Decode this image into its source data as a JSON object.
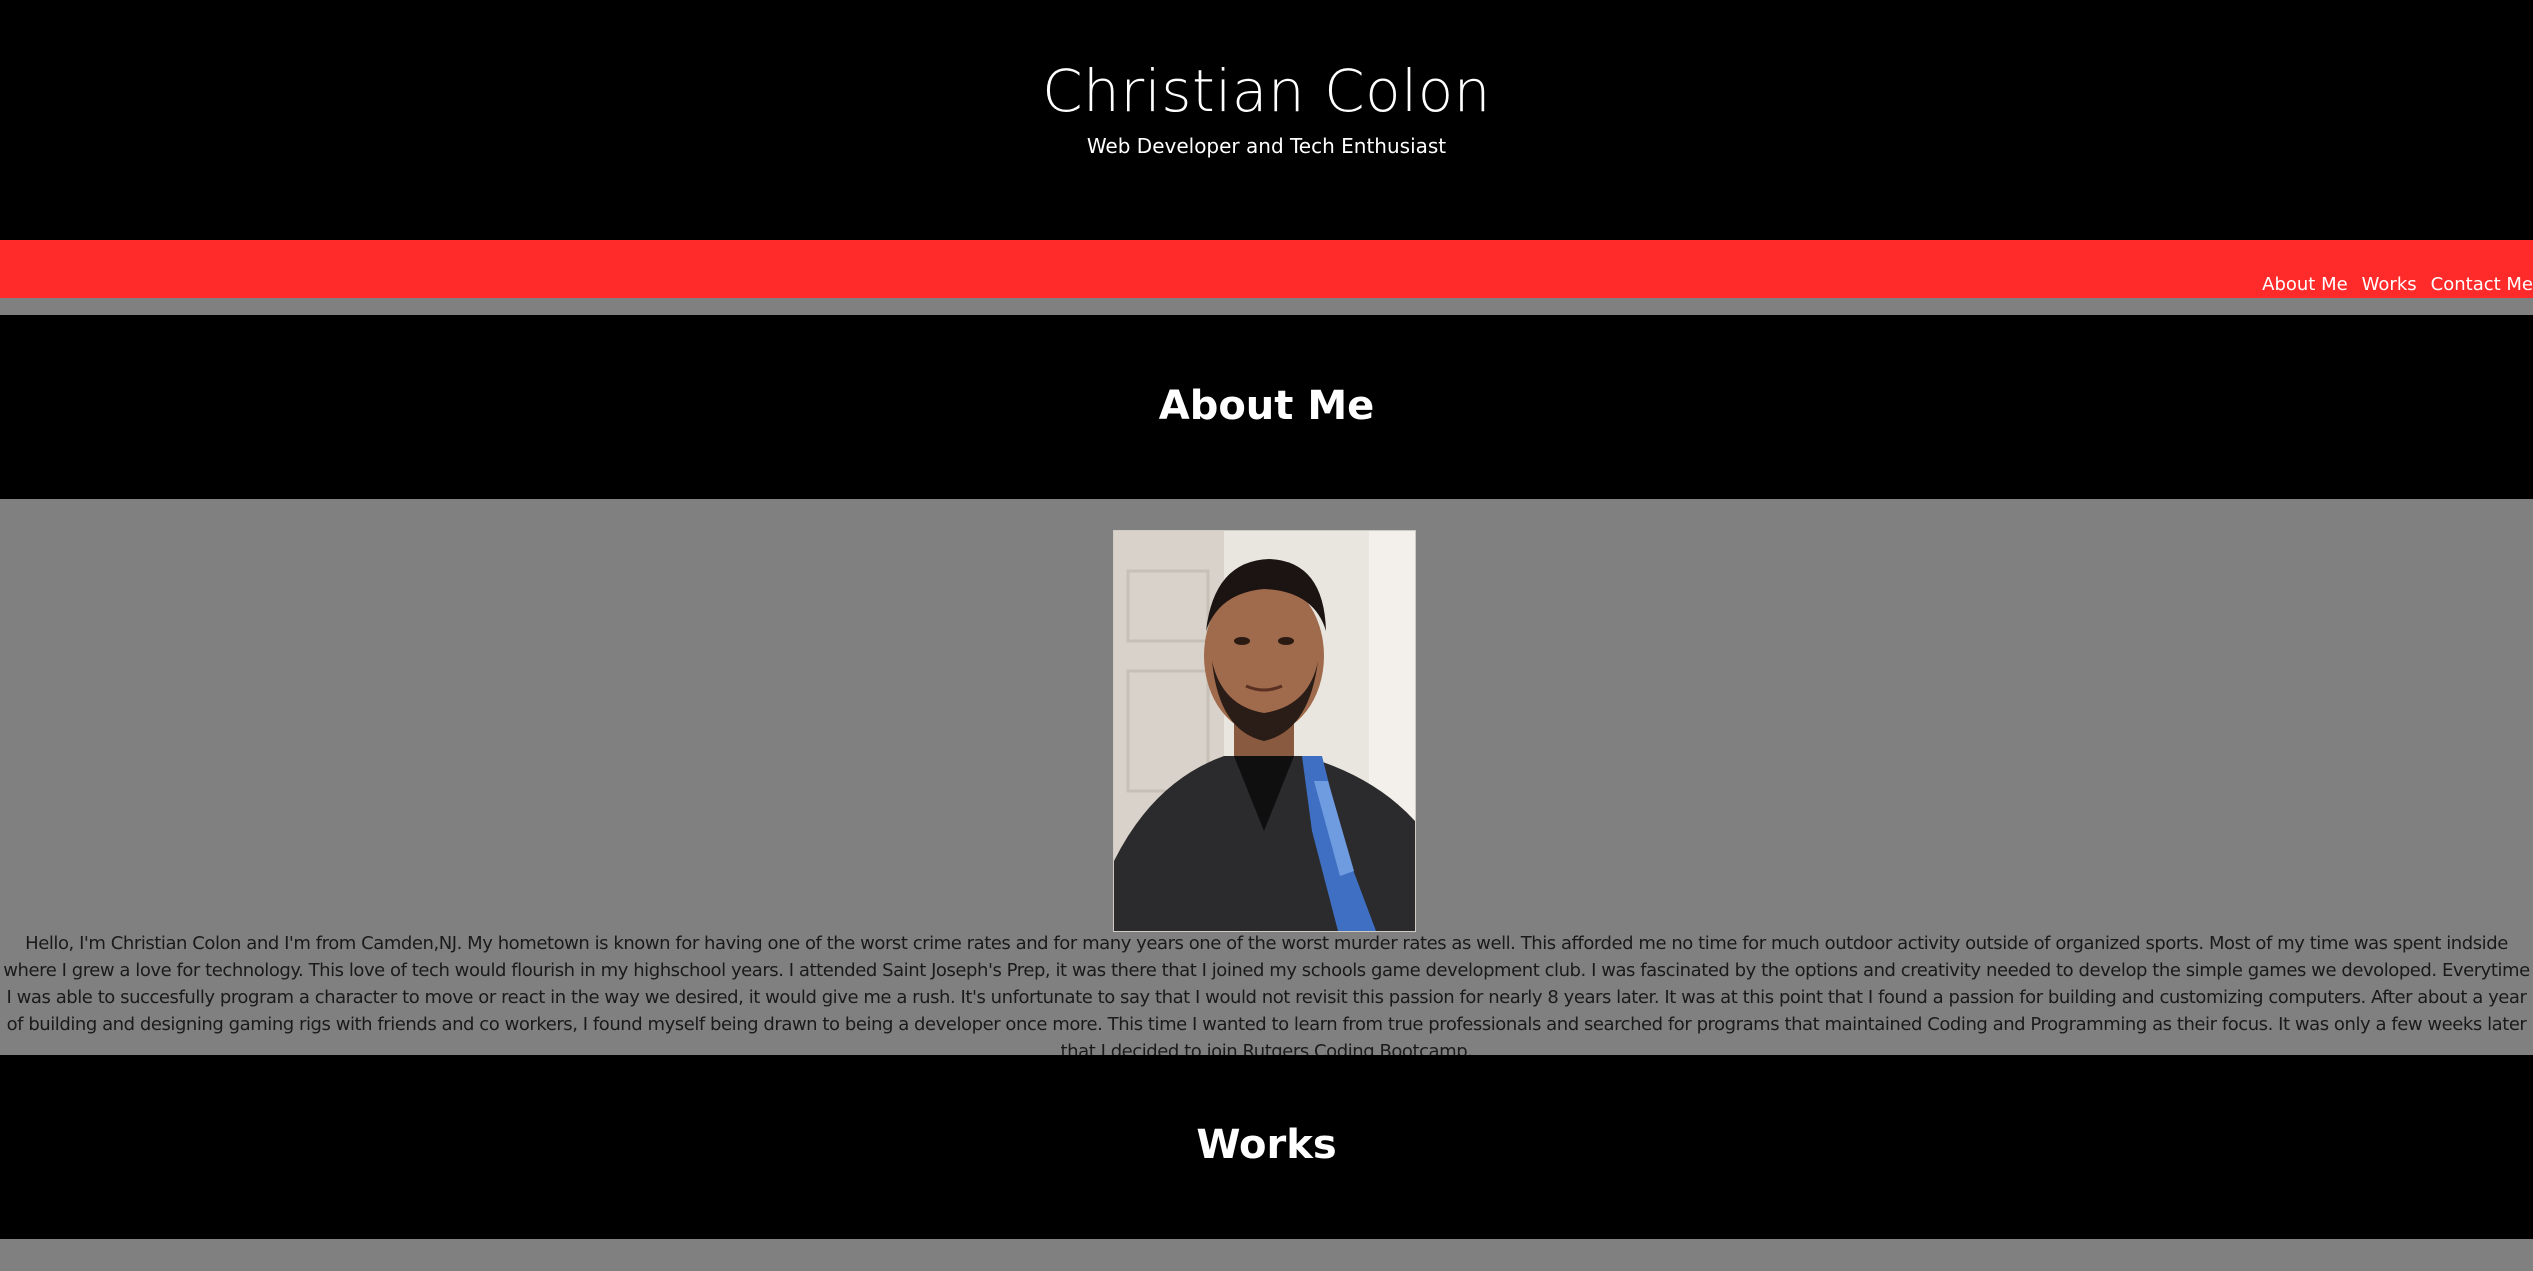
{
  "header": {
    "title": "Christian Colon",
    "subtitle": "Web Developer and Tech Enthusiast"
  },
  "nav": {
    "items": [
      "About Me",
      "Works",
      "Contact Me"
    ]
  },
  "about": {
    "heading": "About Me",
    "photo_icon": "profile-photo",
    "bio": "Hello, I'm Christian Colon and I'm from Camden,NJ. My hometown is known for having one of the worst crime rates and for many years one of the worst murder rates as well. This afforded me no time for much outdoor activity outside of organized sports. Most of my time was spent indside where I grew a love for technology. This love of tech would flourish in my highschool years. I attended Saint Joseph's Prep, it was there that I joined my schools game development club. I was fascinated by the options and creativity needed to develop the simple games we devoloped. Everytime I was able to succesfully program a character to move or react in the way we desired, it would give me a rush. It's unfortunate to say that I would not revisit this passion for nearly 8 years later. It was at this point that I found a passion for building and customizing computers. After about a year of building and designing gaming rigs with friends and co workers, I found myself being drawn to being a developer once more. This time I wanted to learn from true professionals and searched for programs that maintained Coding and Programming as their focus. It was only a few weeks later that I decided to join Rutgers Coding Bootcamp."
  },
  "works": {
    "heading": "Works"
  },
  "colors": {
    "header_bg": "#000000",
    "nav_bg": "#ff2a2a",
    "body_bg": "#808080",
    "band_bg": "#000000",
    "text_light": "#ffffff",
    "text_dark": "#1a1a1a"
  }
}
